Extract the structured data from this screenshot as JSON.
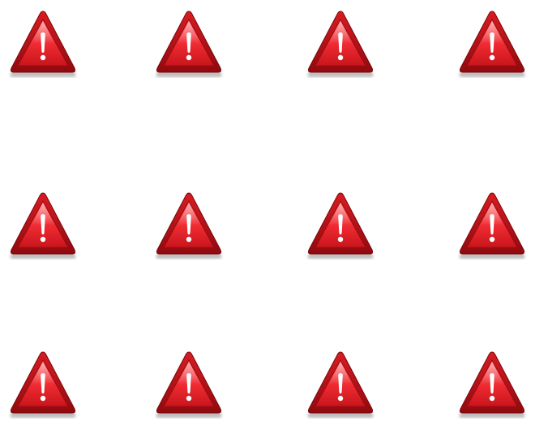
{
  "icons": {
    "name": "warning-icon",
    "rows": 3,
    "columns": 4,
    "colors": {
      "outer": "#b00d12",
      "inner": "#ef2c33",
      "highlight": "#ff6a6e",
      "mark": "#ffffff",
      "shadow": "#9a9a9a"
    }
  }
}
